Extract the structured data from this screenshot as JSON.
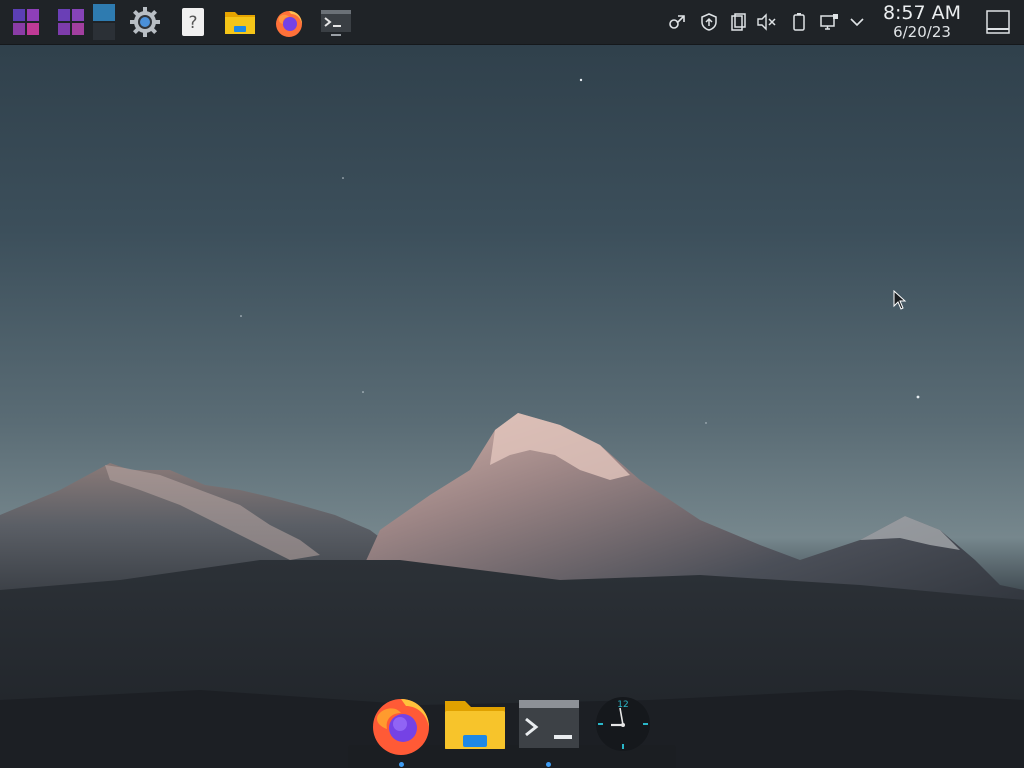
{
  "top_panel": {
    "launchers": [
      {
        "name": "application-launcher-icon",
        "color": "#8e44ad"
      },
      {
        "name": "application-dashboard-icon",
        "color": "#7d3c98"
      },
      {
        "name": "virtual-desktop-pager-icon",
        "color": "#2e7bb0"
      },
      {
        "name": "system-settings-icon",
        "color": "#4a90d9"
      },
      {
        "name": "help-icon",
        "color": "#f0f0f0"
      },
      {
        "name": "file-manager-icon",
        "color": "#f5b800"
      },
      {
        "name": "firefox-icon",
        "color": "#ff7139"
      },
      {
        "name": "terminal-icon",
        "color": "#3a3f44"
      }
    ],
    "tray": [
      {
        "name": "kde-connect-icon"
      },
      {
        "name": "update-notifier-icon"
      },
      {
        "name": "clipboard-icon"
      },
      {
        "name": "volume-muted-icon"
      },
      {
        "name": "battery-icon"
      },
      {
        "name": "network-wired-icon"
      },
      {
        "name": "tray-expand-chevron-icon"
      }
    ],
    "clock": {
      "time": "8:57 AM",
      "date": "6/20/23"
    },
    "show_desktop": {
      "name": "show-desktop-icon"
    }
  },
  "dock": {
    "items": [
      {
        "name": "firefox",
        "running": true
      },
      {
        "name": "file-manager",
        "running": false
      },
      {
        "name": "terminal",
        "running": true
      },
      {
        "name": "analog-clock",
        "clock_label": "12"
      }
    ]
  },
  "colors": {
    "panel_bg": "#1f2327",
    "accent": "#3d9bf2",
    "folder_yellow": "#f5b800",
    "folder_blue": "#1e88e5"
  }
}
